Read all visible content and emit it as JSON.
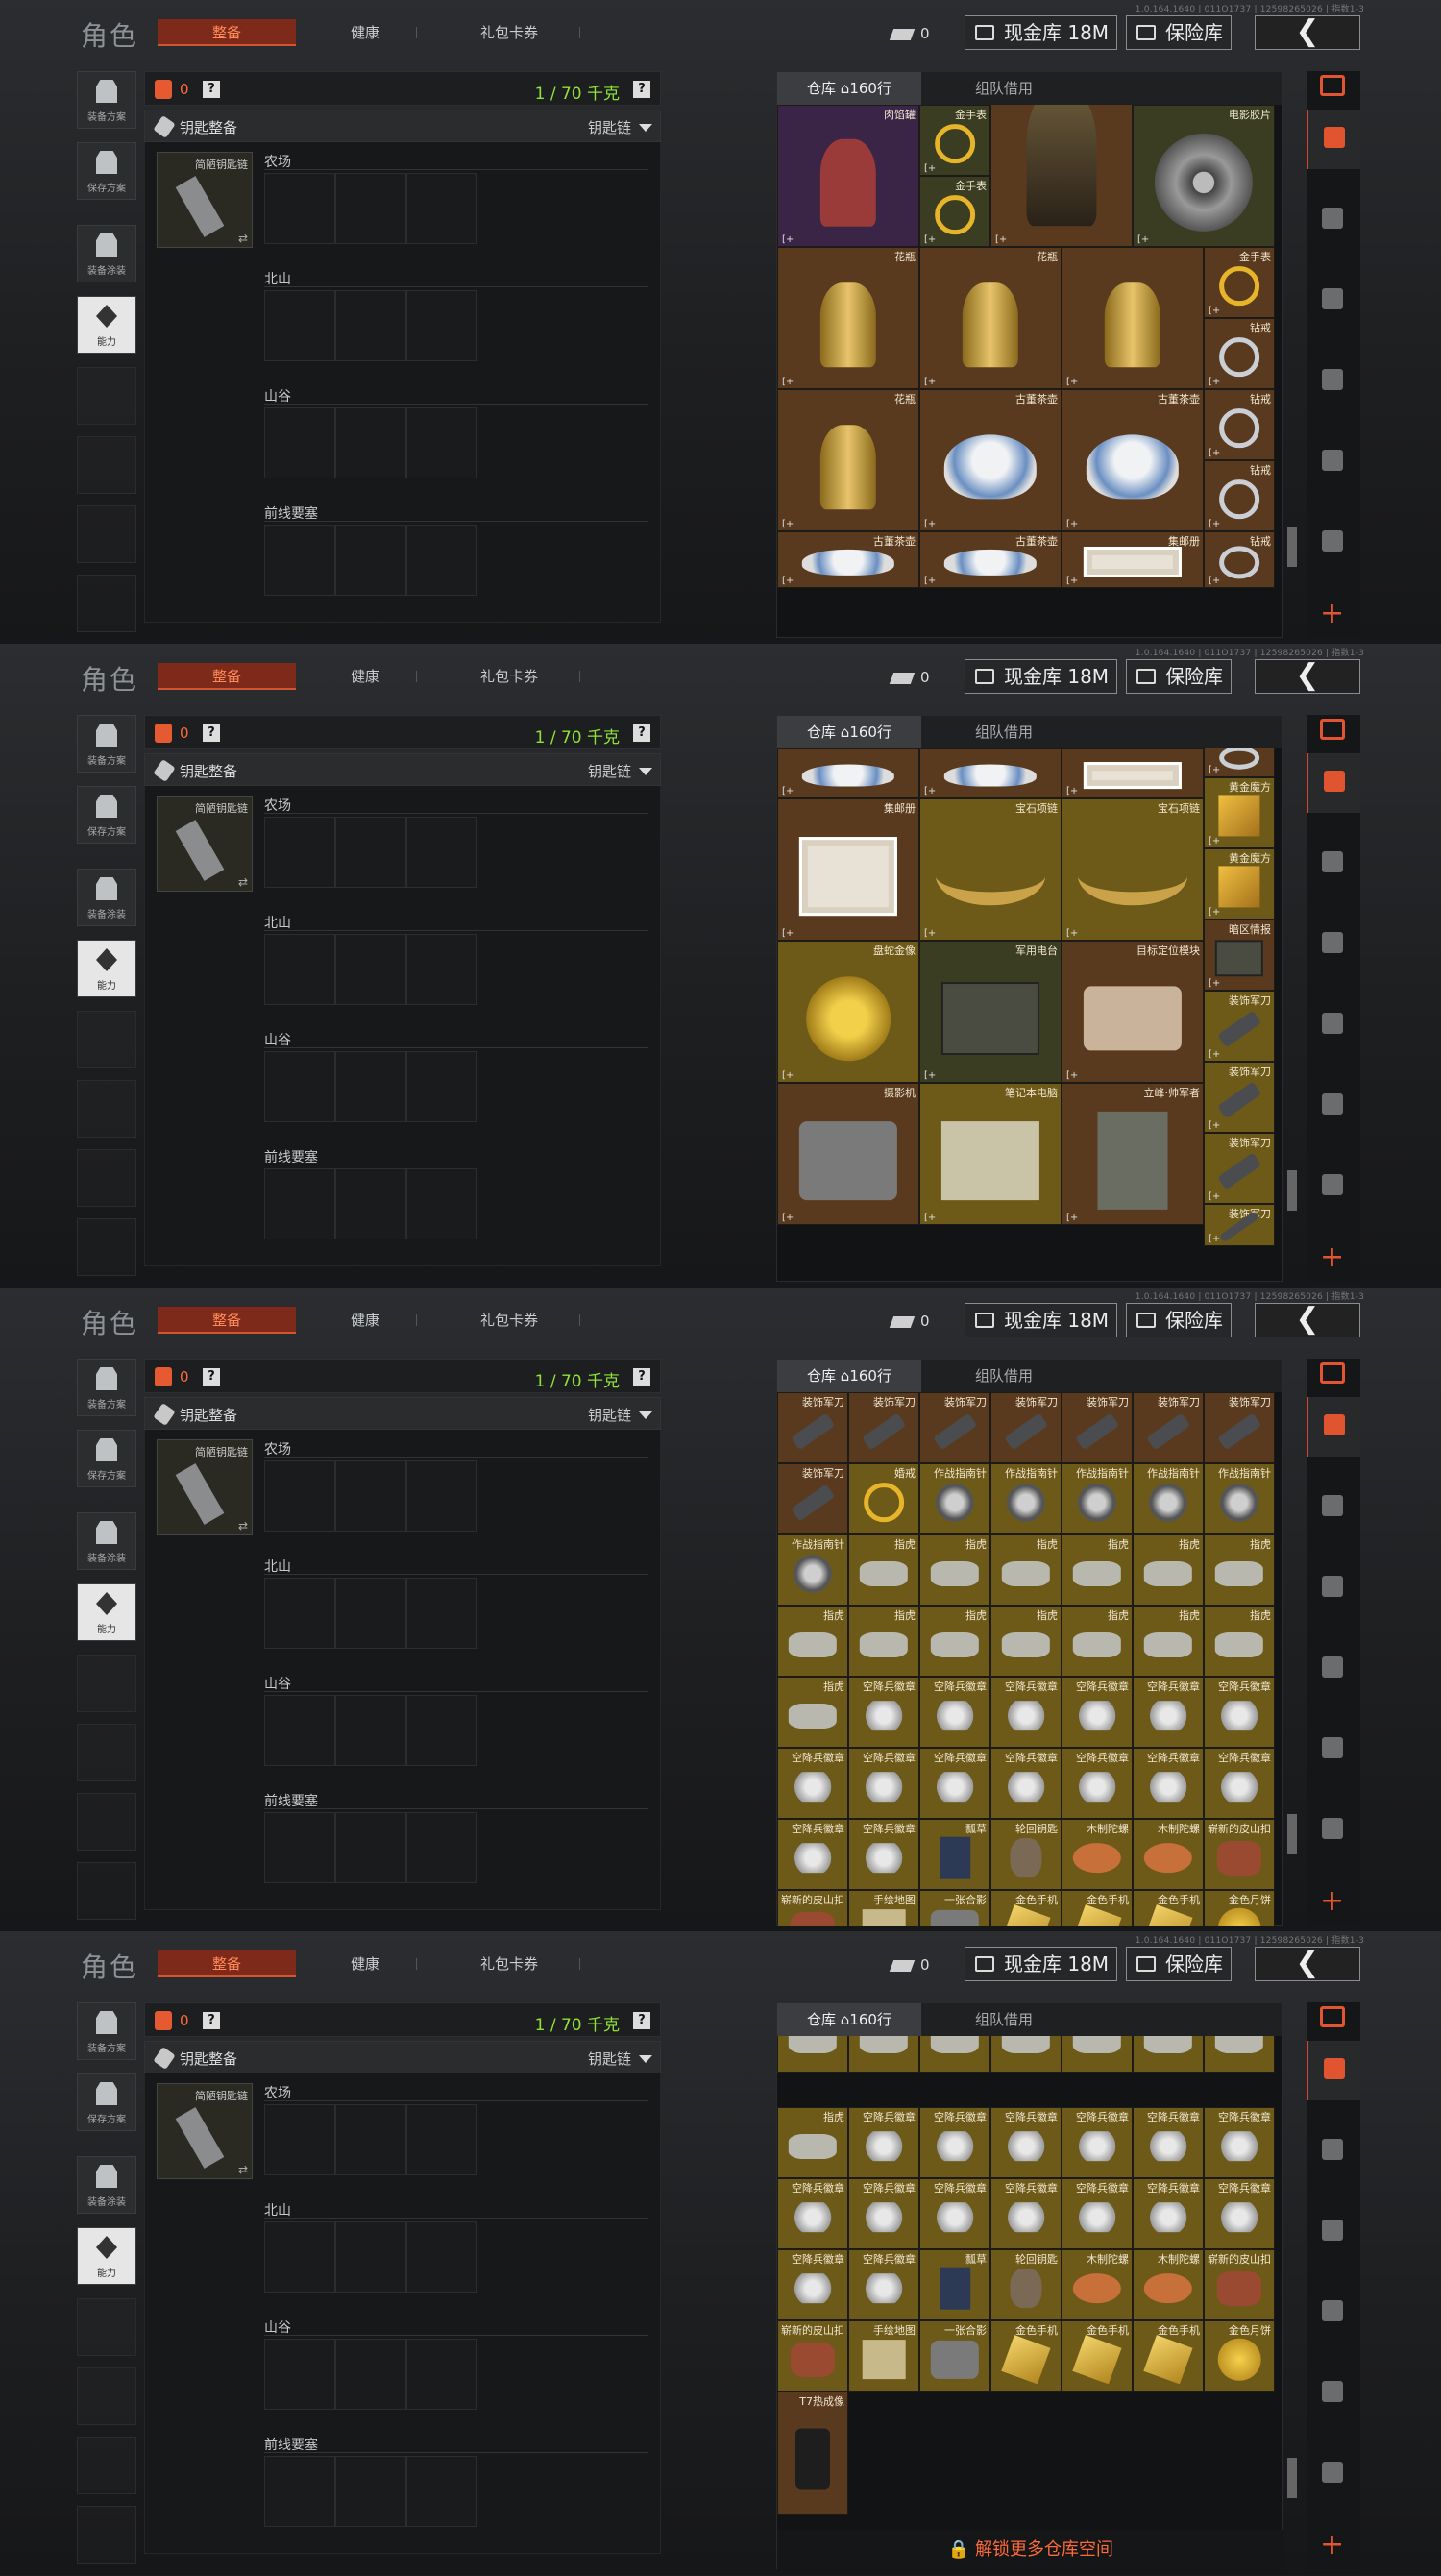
{
  "version": "1.0.164.1640 | 011O1737 | 12598265026 | 指数1-3",
  "header": {
    "title": "角色",
    "tabs": [
      "整备",
      "健康",
      "礼包卡券"
    ],
    "active_tab": "整备",
    "coins": "0",
    "cash_label": "现金库 18M",
    "vault_label": "保险库",
    "back_icon": "chevron-left-icon"
  },
  "left_menu": [
    {
      "label": "装备方案",
      "icon": "vest-icon"
    },
    {
      "label": "保存方案",
      "icon": "download-icon"
    },
    {
      "label": "装备涂装",
      "icon": "helmet-icon"
    },
    {
      "label": "能力",
      "icon": "ability-icon"
    }
  ],
  "capacity": {
    "count": "0",
    "weight": "1 / 70 千克",
    "help": "?"
  },
  "keychain": {
    "label": "钥匙整备",
    "chain": "钥匙链",
    "item_name": "简陋钥匙链"
  },
  "regions": [
    "农场",
    "北山",
    "山谷",
    "前线要塞"
  ],
  "warehouse": {
    "tabs": [
      "仓库",
      "组队借用"
    ],
    "rows": "160行",
    "unlock_label": "解锁更多仓库空间"
  },
  "colors": {
    "accent": "#e25530",
    "weight": "#8fe23a",
    "orange_cell": "#5a3a1e",
    "yellow_cell": "#6d5a18"
  },
  "panel1_items": [
    {
      "name": "",
      "icon": "pot-icon"
    },
    {
      "name": "肉馅罐",
      "icon": "gas-icon"
    },
    {
      "name": "金手表",
      "icon": "gring-icon"
    },
    {
      "name": "金手表",
      "icon": "gring-icon"
    },
    {
      "name": "",
      "icon": "bust-icon"
    },
    {
      "name": "电影胶片",
      "icon": "reel-icon"
    },
    {
      "name": "花瓶",
      "icon": "vase-icon"
    },
    {
      "name": "花瓶",
      "icon": "vase-icon"
    },
    {
      "name": "",
      "icon": "vase-icon"
    },
    {
      "name": "金手表",
      "icon": "gring-icon"
    },
    {
      "name": "钻戒",
      "icon": "ring-icon"
    },
    {
      "name": "花瓶",
      "icon": "vase-icon"
    },
    {
      "name": "古董茶壶",
      "icon": "teapot-icon"
    },
    {
      "name": "古董茶壶",
      "icon": "teapot-icon"
    },
    {
      "name": "钻戒",
      "icon": "ring-icon"
    },
    {
      "name": "钻戒",
      "icon": "ring-icon"
    },
    {
      "name": "古董茶壶",
      "icon": "teapot-icon"
    },
    {
      "name": "古董茶壶",
      "icon": "teapot-icon"
    },
    {
      "name": "集邮册",
      "icon": "stamp-icon"
    },
    {
      "name": "钻戒",
      "icon": "ring-icon"
    }
  ],
  "panel2_items": [
    {
      "name": "",
      "icon": "teapot-icon"
    },
    {
      "name": "",
      "icon": "teapot-icon"
    },
    {
      "name": "",
      "icon": "stamp-icon"
    },
    {
      "name": "",
      "icon": "ring-icon"
    },
    {
      "name": "黄金魔方",
      "icon": "cube-icon"
    },
    {
      "name": "黄金魔方",
      "icon": "cube-icon"
    },
    {
      "name": "集邮册",
      "icon": "stamp-icon"
    },
    {
      "name": "宝石项链",
      "icon": "neck-icon"
    },
    {
      "name": "宝石项链",
      "icon": "neck-icon"
    },
    {
      "name": "暗区情报",
      "icon": "book-icon"
    },
    {
      "name": "盘蛇金像",
      "icon": "snake-icon"
    },
    {
      "name": "军用电台",
      "icon": "radio-icon"
    },
    {
      "name": "目标定位模块",
      "icon": "laser-icon"
    },
    {
      "name": "装饰军刀",
      "icon": "knife-icon"
    },
    {
      "name": "装饰军刀",
      "icon": "knife-icon"
    },
    {
      "name": "摄影机",
      "icon": "camera-icon"
    },
    {
      "name": "笔记本电脑",
      "icon": "laptop-icon"
    },
    {
      "name": "立峰·帅军者",
      "icon": "fig-icon"
    },
    {
      "name": "装饰军刀",
      "icon": "knife-icon"
    },
    {
      "name": "装饰军刀",
      "icon": "knife-icon"
    }
  ],
  "panel3_rows": [
    [
      "装饰军刀",
      "装饰军刀",
      "装饰军刀",
      "装饰军刀",
      "装饰军刀",
      "装饰军刀",
      "装饰军刀"
    ],
    [
      "装饰军刀",
      "婚戒",
      "作战指南针",
      "作战指南针",
      "作战指南针",
      "作战指南针",
      "作战指南针"
    ],
    [
      "作战指南针",
      "指虎",
      "指虎",
      "指虎",
      "指虎",
      "指虎",
      "指虎"
    ],
    [
      "指虎",
      "指虎",
      "指虎",
      "指虎",
      "指虎",
      "指虎",
      "指虎"
    ],
    [
      "指虎",
      "空降兵徽章",
      "空降兵徽章",
      "空降兵徽章",
      "空降兵徽章",
      "空降兵徽章",
      "空降兵徽章"
    ],
    [
      "空降兵徽章",
      "空降兵徽章",
      "空降兵徽章",
      "空降兵徽章",
      "空降兵徽章",
      "空降兵徽章",
      "空降兵徽章"
    ],
    [
      "空降兵徽章",
      "空降兵徽章",
      "瓢草",
      "轮回钥匙",
      "木制陀螺",
      "木制陀螺",
      "崭新的皮山扣"
    ],
    [
      "崭新的皮山扣",
      "手绘地图",
      "一张合影",
      "金色手机",
      "金色手机",
      "金色手机",
      "金色月饼"
    ]
  ],
  "panel4_rows": [
    [
      "",
      "",
      "",
      "",
      "",
      "",
      ""
    ],
    [
      "指虎",
      "空降兵徽章",
      "空降兵徽章",
      "空降兵徽章",
      "空降兵徽章",
      "空降兵徽章",
      "空降兵徽章"
    ],
    [
      "空降兵徽章",
      "空降兵徽章",
      "空降兵徽章",
      "空降兵徽章",
      "空降兵徽章",
      "空降兵徽章",
      "空降兵徽章"
    ],
    [
      "空降兵徽章",
      "空降兵徽章",
      "瓢草",
      "轮回钥匙",
      "木制陀螺",
      "木制陀螺",
      "崭新的皮山扣"
    ],
    [
      "崭新的皮山扣",
      "手绘地图",
      "一张合影",
      "金色手机",
      "金色手机",
      "金色手机",
      "金色月饼"
    ],
    [
      "T7热成像",
      "",
      "",
      "",
      "",
      "",
      ""
    ]
  ]
}
